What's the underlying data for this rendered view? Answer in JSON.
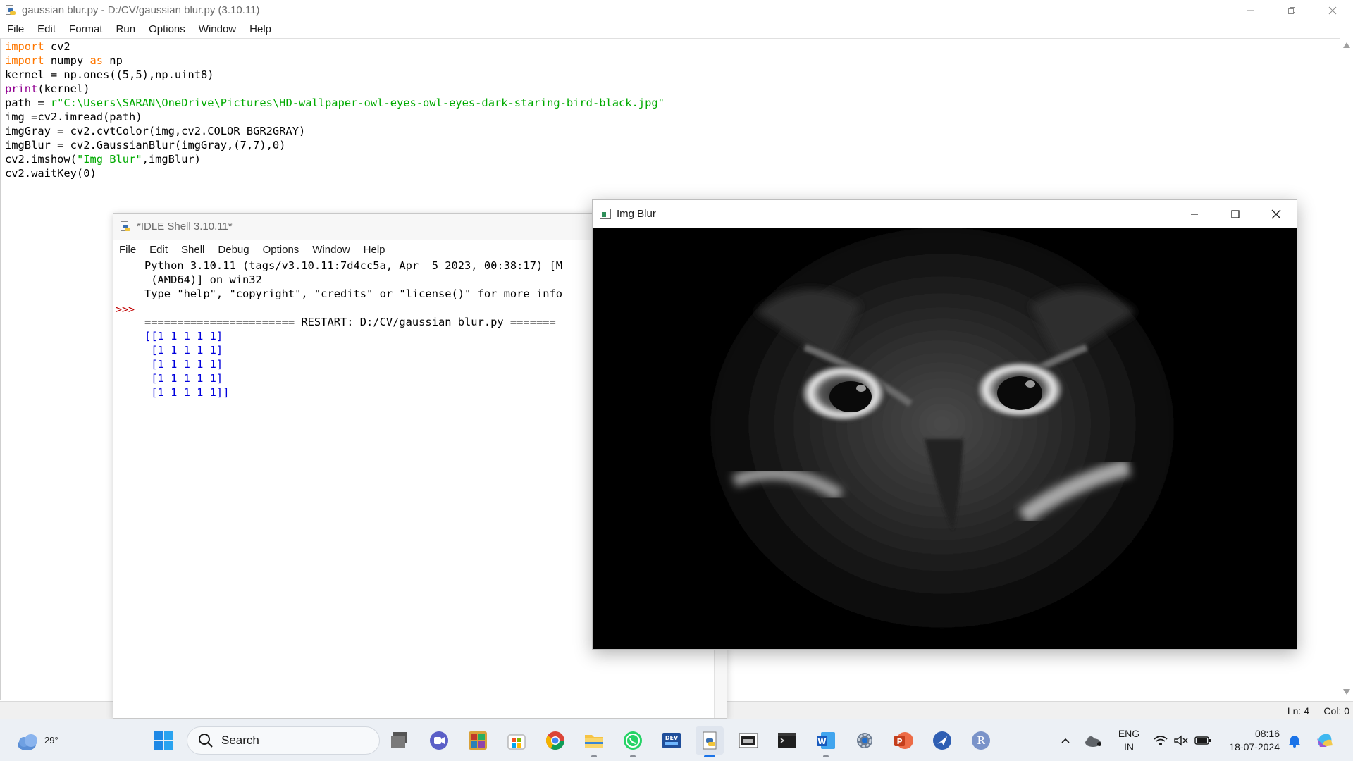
{
  "editor": {
    "title": "gaussian blur.py - D:/CV/gaussian blur.py (3.10.11)",
    "menu": [
      "File",
      "Edit",
      "Format",
      "Run",
      "Options",
      "Window",
      "Help"
    ],
    "status": {
      "line": "Ln: 4",
      "col": "Col: 0"
    },
    "code_lines": [
      [
        {
          "t": "import",
          "c": "kw"
        },
        {
          "t": " cv2",
          "c": ""
        }
      ],
      [
        {
          "t": "import",
          "c": "kw"
        },
        {
          "t": " numpy ",
          "c": ""
        },
        {
          "t": "as",
          "c": "kw"
        },
        {
          "t": " np",
          "c": ""
        }
      ],
      [
        {
          "t": "kernel = np.ones((5,5),np.uint8)",
          "c": ""
        }
      ],
      [
        {
          "t": "print",
          "c": "bi"
        },
        {
          "t": "(kernel)",
          "c": ""
        }
      ],
      [
        {
          "t": "path = ",
          "c": ""
        },
        {
          "t": "r\"C:\\Users\\SARAN\\OneDrive\\Pictures\\HD-wallpaper-owl-eyes-owl-eyes-dark-staring-bird-black.jpg\"",
          "c": "str"
        }
      ],
      [
        {
          "t": "img =cv2.imread(path)",
          "c": ""
        }
      ],
      [
        {
          "t": "imgGray = cv2.cvtColor(img,cv2.COLOR_BGR2GRAY)",
          "c": ""
        }
      ],
      [
        {
          "t": "imgBlur = cv2.GaussianBlur(imgGray,(7,7),0)",
          "c": ""
        }
      ],
      [
        {
          "t": "cv2.imshow(",
          "c": ""
        },
        {
          "t": "\"Img Blur\"",
          "c": "str"
        },
        {
          "t": ",imgBlur)",
          "c": ""
        }
      ],
      [
        {
          "t": "cv2.waitKey(0)",
          "c": ""
        }
      ]
    ]
  },
  "shell": {
    "title": "*IDLE Shell 3.10.11*",
    "menu": [
      "File",
      "Edit",
      "Shell",
      "Debug",
      "Options",
      "Window",
      "Help"
    ],
    "prompt": ">>>",
    "lines": [
      {
        "t": "Python 3.10.11 (tags/v3.10.11:7d4cc5a, Apr  5 2023, 00:38:17) [M",
        "c": ""
      },
      {
        "t": " (AMD64)] on win32",
        "c": ""
      },
      {
        "t": "Type \"help\", \"copyright\", \"credits\" or \"license()\" for more info",
        "c": ""
      },
      {
        "t": "",
        "c": ""
      },
      {
        "t": "======================= RESTART: D:/CV/gaussian blur.py =======",
        "c": ""
      },
      {
        "t": "[[1 1 1 1 1]",
        "c": "out"
      },
      {
        "t": " [1 1 1 1 1]",
        "c": "out"
      },
      {
        "t": " [1 1 1 1 1]",
        "c": "out"
      },
      {
        "t": " [1 1 1 1 1]",
        "c": "out"
      },
      {
        "t": " [1 1 1 1 1]]",
        "c": "out"
      }
    ]
  },
  "image_window": {
    "title": "Img Blur",
    "buttons": [
      "minimize",
      "maximize",
      "close"
    ]
  },
  "taskbar": {
    "weather": {
      "temp": "29°",
      "icon": "cloud-weather-icon"
    },
    "search_label": "Search",
    "apps": [
      "windows-start-icon",
      "task-view-icon",
      "teams-meet-icon",
      "photos-icon",
      "microsoft-store-icon",
      "chrome-icon",
      "file-explorer-icon",
      "whatsapp-icon",
      "devtoys-icon",
      "idle-python-icon",
      "photo-viewer-icon",
      "terminal-icon",
      "word-icon",
      "settings-icon",
      "powerpoint-icon",
      "feedback-icon",
      "r-icon"
    ],
    "tray": {
      "language": "ENG",
      "region": "IN",
      "time": "08:16",
      "date": "18-07-2024"
    }
  }
}
